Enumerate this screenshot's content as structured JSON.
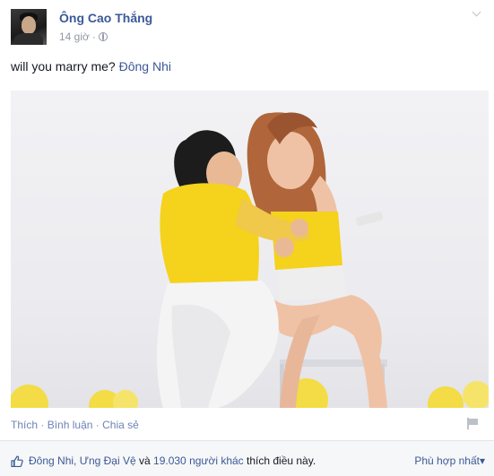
{
  "post": {
    "author": "Ông Cao Thắng",
    "time": "14 giờ",
    "separator": "·",
    "status_text": "will you marry me?",
    "status_tag": "Đông Nhi",
    "privacy_icon": "globe-icon",
    "options_icon": "chevron-down-icon"
  },
  "actions": {
    "like": "Thích",
    "comment": "Bình luận",
    "share": "Chia sẻ",
    "separator": "·",
    "flag_icon": "flag-icon"
  },
  "likes": {
    "icon": "thumbs-up-icon",
    "names": "Đông Nhi, Ưng Đại Vệ",
    "conjunction": "và",
    "others": "19.030 người khác",
    "suffix": "thích điều này.",
    "sort_label": "Phù hợp nhất",
    "sort_arrow": "▾"
  },
  "colors": {
    "link": "#3b5998",
    "meta": "#9197a3",
    "text": "#141823",
    "shirt": "#f5d21c"
  }
}
